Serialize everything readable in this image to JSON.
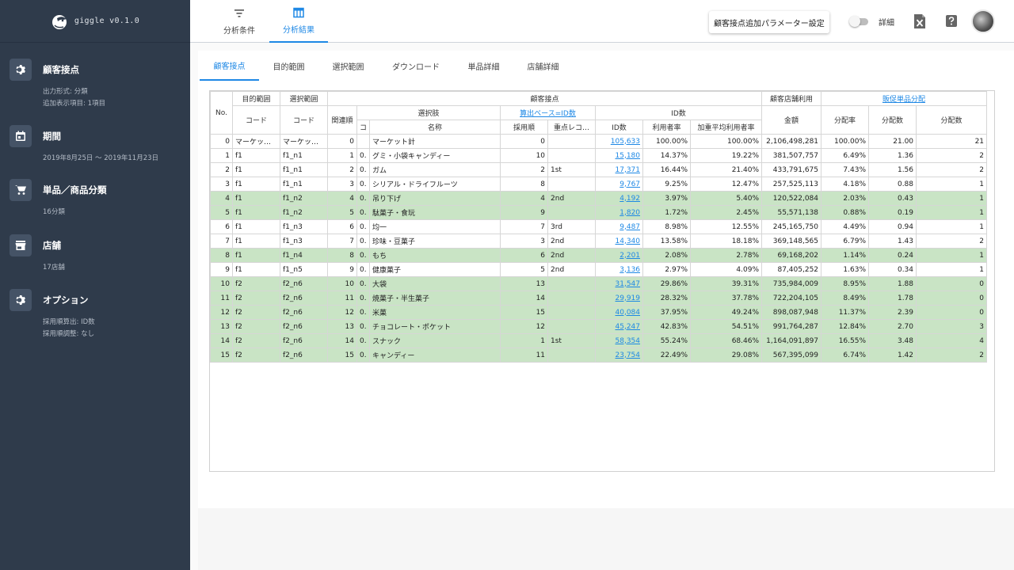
{
  "app": {
    "name": "giggle v0.1.0"
  },
  "sidebar": [
    {
      "icon": "gear-icon",
      "title": "顧客接点",
      "sub": [
        "出力形式: 分類",
        "追加表示項目: 1項目"
      ]
    },
    {
      "icon": "calendar-icon",
      "title": "期間",
      "sub": [
        "2019年8月25日 〜 2019年11月23日"
      ]
    },
    {
      "icon": "cart-icon",
      "title": "単品／商品分類",
      "sub": [
        "16分類"
      ]
    },
    {
      "icon": "store-icon",
      "title": "店舗",
      "sub": [
        "17店舗"
      ]
    },
    {
      "icon": "gear-icon",
      "title": "オプション",
      "sub": [
        "採用順算出: ID数",
        "採用順調整: なし"
      ]
    }
  ],
  "header": {
    "tabs": [
      {
        "label": "分析条件",
        "icon": "filter-icon",
        "active": false
      },
      {
        "label": "分析結果",
        "icon": "table-icon",
        "active": true
      }
    ],
    "param_button": "顧客接点追加パラメーター設定",
    "toggle_label": "詳細",
    "toggle_on": false
  },
  "subtabs": [
    "顧客接点",
    "目的範囲",
    "選択範囲",
    "ダウンロード",
    "単品詳細",
    "店舗詳細"
  ],
  "table": {
    "head": {
      "no": "No.",
      "purpose": "目的範囲",
      "selection": "選択範囲",
      "touchpoint": "顧客接点",
      "store_usage": "顧客店舗利用",
      "promo": "販促単品分配",
      "code": "コード",
      "relevance": "関連順",
      "choices": "選択肢",
      "calc_base": "算出ベース=ID数",
      "id_count": "ID数",
      "ko": "コ",
      "name": "名称",
      "adopt_order": "採用順",
      "key_record": "重点レコ…",
      "usage_rate": "利用者率",
      "weighted_rate": "加重平均利用者率",
      "amount": "金額",
      "dist_rate": "分配率",
      "dist_count": "分配数",
      "dist_count2": "分配数"
    },
    "rows": [
      {
        "no": "0",
        "purpose": "マーケッ…",
        "sel": "マーケッ…",
        "rel": "0",
        "ko": "",
        "name": "マーケット計",
        "adopt": "0",
        "key": "",
        "ids": "105,633",
        "rate": "100.00%",
        "wrate": "100.00%",
        "amount": "2,106,498,281",
        "drate": "100.00%",
        "dcount": "21.00",
        "dcount2": "21",
        "hl": false
      },
      {
        "no": "1",
        "purpose": "f1",
        "sel": "f1_n1",
        "rel": "1",
        "ko": "0.",
        "name": "グミ・小袋キャンディー",
        "adopt": "10",
        "key": "",
        "ids": "15,180",
        "rate": "14.37%",
        "wrate": "19.22%",
        "amount": "381,507,757",
        "drate": "6.49%",
        "dcount": "1.36",
        "dcount2": "2",
        "hl": false
      },
      {
        "no": "2",
        "purpose": "f1",
        "sel": "f1_n1",
        "rel": "2",
        "ko": "0.",
        "name": "ガム",
        "adopt": "2",
        "key": "1st",
        "ids": "17,371",
        "rate": "16.44%",
        "wrate": "21.40%",
        "amount": "433,791,675",
        "drate": "7.43%",
        "dcount": "1.56",
        "dcount2": "2",
        "hl": false
      },
      {
        "no": "3",
        "purpose": "f1",
        "sel": "f1_n1",
        "rel": "3",
        "ko": "0.",
        "name": "シリアル・ドライフルーツ",
        "adopt": "8",
        "key": "",
        "ids": "9,767",
        "rate": "9.25%",
        "wrate": "12.47%",
        "amount": "257,525,113",
        "drate": "4.18%",
        "dcount": "0.88",
        "dcount2": "1",
        "hl": false
      },
      {
        "no": "4",
        "purpose": "f1",
        "sel": "f1_n2",
        "rel": "4",
        "ko": "0.",
        "name": "吊り下げ",
        "adopt": "4",
        "key": "2nd",
        "ids": "4,192",
        "rate": "3.97%",
        "wrate": "5.40%",
        "amount": "120,522,084",
        "drate": "2.03%",
        "dcount": "0.43",
        "dcount2": "1",
        "hl": true
      },
      {
        "no": "5",
        "purpose": "f1",
        "sel": "f1_n2",
        "rel": "5",
        "ko": "0.",
        "name": "駄菓子・食玩",
        "adopt": "9",
        "key": "",
        "ids": "1,820",
        "rate": "1.72%",
        "wrate": "2.45%",
        "amount": "55,571,138",
        "drate": "0.88%",
        "dcount": "0.19",
        "dcount2": "1",
        "hl": true
      },
      {
        "no": "6",
        "purpose": "f1",
        "sel": "f1_n3",
        "rel": "6",
        "ko": "0.",
        "name": "均一",
        "adopt": "7",
        "key": "3rd",
        "ids": "9,487",
        "rate": "8.98%",
        "wrate": "12.55%",
        "amount": "245,165,750",
        "drate": "4.49%",
        "dcount": "0.94",
        "dcount2": "1",
        "hl": false
      },
      {
        "no": "7",
        "purpose": "f1",
        "sel": "f1_n3",
        "rel": "7",
        "ko": "0.",
        "name": "珍味・豆菓子",
        "adopt": "3",
        "key": "2nd",
        "ids": "14,340",
        "rate": "13.58%",
        "wrate": "18.18%",
        "amount": "369,148,565",
        "drate": "6.79%",
        "dcount": "1.43",
        "dcount2": "2",
        "hl": false
      },
      {
        "no": "8",
        "purpose": "f1",
        "sel": "f1_n4",
        "rel": "8",
        "ko": "0.",
        "name": "もち",
        "adopt": "6",
        "key": "2nd",
        "ids": "2,201",
        "rate": "2.08%",
        "wrate": "2.78%",
        "amount": "69,168,202",
        "drate": "1.14%",
        "dcount": "0.24",
        "dcount2": "1",
        "hl": true
      },
      {
        "no": "9",
        "purpose": "f1",
        "sel": "f1_n5",
        "rel": "9",
        "ko": "0.",
        "name": "健康菓子",
        "adopt": "5",
        "key": "2nd",
        "ids": "3,136",
        "rate": "2.97%",
        "wrate": "4.09%",
        "amount": "87,405,252",
        "drate": "1.63%",
        "dcount": "0.34",
        "dcount2": "1",
        "hl": false
      },
      {
        "no": "10",
        "purpose": "f2",
        "sel": "f2_n6",
        "rel": "10",
        "ko": "0.",
        "name": "大袋",
        "adopt": "13",
        "key": "",
        "ids": "31,547",
        "rate": "29.86%",
        "wrate": "39.31%",
        "amount": "735,984,009",
        "drate": "8.95%",
        "dcount": "1.88",
        "dcount2": "0",
        "hl": true
      },
      {
        "no": "11",
        "purpose": "f2",
        "sel": "f2_n6",
        "rel": "11",
        "ko": "0.",
        "name": "焼菓子・半生菓子",
        "adopt": "14",
        "key": "",
        "ids": "29,919",
        "rate": "28.32%",
        "wrate": "37.78%",
        "amount": "722,204,105",
        "drate": "8.49%",
        "dcount": "1.78",
        "dcount2": "0",
        "hl": true
      },
      {
        "no": "12",
        "purpose": "f2",
        "sel": "f2_n6",
        "rel": "12",
        "ko": "0.",
        "name": "米菓",
        "adopt": "15",
        "key": "",
        "ids": "40,084",
        "rate": "37.95%",
        "wrate": "49.24%",
        "amount": "898,087,948",
        "drate": "11.37%",
        "dcount": "2.39",
        "dcount2": "0",
        "hl": true
      },
      {
        "no": "13",
        "purpose": "f2",
        "sel": "f2_n6",
        "rel": "13",
        "ko": "0.",
        "name": "チョコレート・ポケット",
        "adopt": "12",
        "key": "",
        "ids": "45,247",
        "rate": "42.83%",
        "wrate": "54.51%",
        "amount": "991,764,287",
        "drate": "12.84%",
        "dcount": "2.70",
        "dcount2": "3",
        "hl": true
      },
      {
        "no": "14",
        "purpose": "f2",
        "sel": "f2_n6",
        "rel": "14",
        "ko": "0.",
        "name": "スナック",
        "adopt": "1",
        "key": "1st",
        "ids": "58,354",
        "rate": "55.24%",
        "wrate": "68.46%",
        "amount": "1,164,091,897",
        "drate": "16.55%",
        "dcount": "3.48",
        "dcount2": "4",
        "hl": true
      },
      {
        "no": "15",
        "purpose": "f2",
        "sel": "f2_n6",
        "rel": "15",
        "ko": "0.",
        "name": "キャンディー",
        "adopt": "11",
        "key": "",
        "ids": "23,754",
        "rate": "22.49%",
        "wrate": "29.08%",
        "amount": "567,395,099",
        "drate": "6.74%",
        "dcount": "1.42",
        "dcount2": "2",
        "hl": true
      }
    ]
  },
  "colors": {
    "sidebar_bg": "#2f3b4b",
    "accent": "#1e88e5",
    "highlight_row": "#c9e4c5"
  }
}
